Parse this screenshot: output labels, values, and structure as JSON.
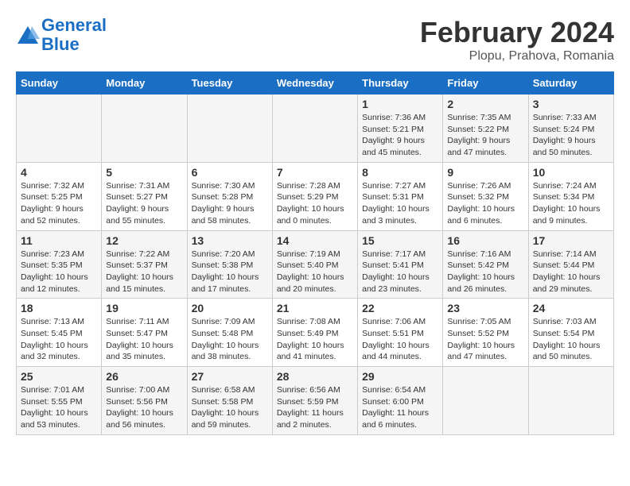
{
  "header": {
    "logo_line1": "General",
    "logo_line2": "Blue",
    "month": "February 2024",
    "location": "Plopu, Prahova, Romania"
  },
  "days_of_week": [
    "Sunday",
    "Monday",
    "Tuesday",
    "Wednesday",
    "Thursday",
    "Friday",
    "Saturday"
  ],
  "weeks": [
    [
      {
        "day": "",
        "info": ""
      },
      {
        "day": "",
        "info": ""
      },
      {
        "day": "",
        "info": ""
      },
      {
        "day": "",
        "info": ""
      },
      {
        "day": "1",
        "info": "Sunrise: 7:36 AM\nSunset: 5:21 PM\nDaylight: 9 hours\nand 45 minutes."
      },
      {
        "day": "2",
        "info": "Sunrise: 7:35 AM\nSunset: 5:22 PM\nDaylight: 9 hours\nand 47 minutes."
      },
      {
        "day": "3",
        "info": "Sunrise: 7:33 AM\nSunset: 5:24 PM\nDaylight: 9 hours\nand 50 minutes."
      }
    ],
    [
      {
        "day": "4",
        "info": "Sunrise: 7:32 AM\nSunset: 5:25 PM\nDaylight: 9 hours\nand 52 minutes."
      },
      {
        "day": "5",
        "info": "Sunrise: 7:31 AM\nSunset: 5:27 PM\nDaylight: 9 hours\nand 55 minutes."
      },
      {
        "day": "6",
        "info": "Sunrise: 7:30 AM\nSunset: 5:28 PM\nDaylight: 9 hours\nand 58 minutes."
      },
      {
        "day": "7",
        "info": "Sunrise: 7:28 AM\nSunset: 5:29 PM\nDaylight: 10 hours\nand 0 minutes."
      },
      {
        "day": "8",
        "info": "Sunrise: 7:27 AM\nSunset: 5:31 PM\nDaylight: 10 hours\nand 3 minutes."
      },
      {
        "day": "9",
        "info": "Sunrise: 7:26 AM\nSunset: 5:32 PM\nDaylight: 10 hours\nand 6 minutes."
      },
      {
        "day": "10",
        "info": "Sunrise: 7:24 AM\nSunset: 5:34 PM\nDaylight: 10 hours\nand 9 minutes."
      }
    ],
    [
      {
        "day": "11",
        "info": "Sunrise: 7:23 AM\nSunset: 5:35 PM\nDaylight: 10 hours\nand 12 minutes."
      },
      {
        "day": "12",
        "info": "Sunrise: 7:22 AM\nSunset: 5:37 PM\nDaylight: 10 hours\nand 15 minutes."
      },
      {
        "day": "13",
        "info": "Sunrise: 7:20 AM\nSunset: 5:38 PM\nDaylight: 10 hours\nand 17 minutes."
      },
      {
        "day": "14",
        "info": "Sunrise: 7:19 AM\nSunset: 5:40 PM\nDaylight: 10 hours\nand 20 minutes."
      },
      {
        "day": "15",
        "info": "Sunrise: 7:17 AM\nSunset: 5:41 PM\nDaylight: 10 hours\nand 23 minutes."
      },
      {
        "day": "16",
        "info": "Sunrise: 7:16 AM\nSunset: 5:42 PM\nDaylight: 10 hours\nand 26 minutes."
      },
      {
        "day": "17",
        "info": "Sunrise: 7:14 AM\nSunset: 5:44 PM\nDaylight: 10 hours\nand 29 minutes."
      }
    ],
    [
      {
        "day": "18",
        "info": "Sunrise: 7:13 AM\nSunset: 5:45 PM\nDaylight: 10 hours\nand 32 minutes."
      },
      {
        "day": "19",
        "info": "Sunrise: 7:11 AM\nSunset: 5:47 PM\nDaylight: 10 hours\nand 35 minutes."
      },
      {
        "day": "20",
        "info": "Sunrise: 7:09 AM\nSunset: 5:48 PM\nDaylight: 10 hours\nand 38 minutes."
      },
      {
        "day": "21",
        "info": "Sunrise: 7:08 AM\nSunset: 5:49 PM\nDaylight: 10 hours\nand 41 minutes."
      },
      {
        "day": "22",
        "info": "Sunrise: 7:06 AM\nSunset: 5:51 PM\nDaylight: 10 hours\nand 44 minutes."
      },
      {
        "day": "23",
        "info": "Sunrise: 7:05 AM\nSunset: 5:52 PM\nDaylight: 10 hours\nand 47 minutes."
      },
      {
        "day": "24",
        "info": "Sunrise: 7:03 AM\nSunset: 5:54 PM\nDaylight: 10 hours\nand 50 minutes."
      }
    ],
    [
      {
        "day": "25",
        "info": "Sunrise: 7:01 AM\nSunset: 5:55 PM\nDaylight: 10 hours\nand 53 minutes."
      },
      {
        "day": "26",
        "info": "Sunrise: 7:00 AM\nSunset: 5:56 PM\nDaylight: 10 hours\nand 56 minutes."
      },
      {
        "day": "27",
        "info": "Sunrise: 6:58 AM\nSunset: 5:58 PM\nDaylight: 10 hours\nand 59 minutes."
      },
      {
        "day": "28",
        "info": "Sunrise: 6:56 AM\nSunset: 5:59 PM\nDaylight: 11 hours\nand 2 minutes."
      },
      {
        "day": "29",
        "info": "Sunrise: 6:54 AM\nSunset: 6:00 PM\nDaylight: 11 hours\nand 6 minutes."
      },
      {
        "day": "",
        "info": ""
      },
      {
        "day": "",
        "info": ""
      }
    ]
  ]
}
